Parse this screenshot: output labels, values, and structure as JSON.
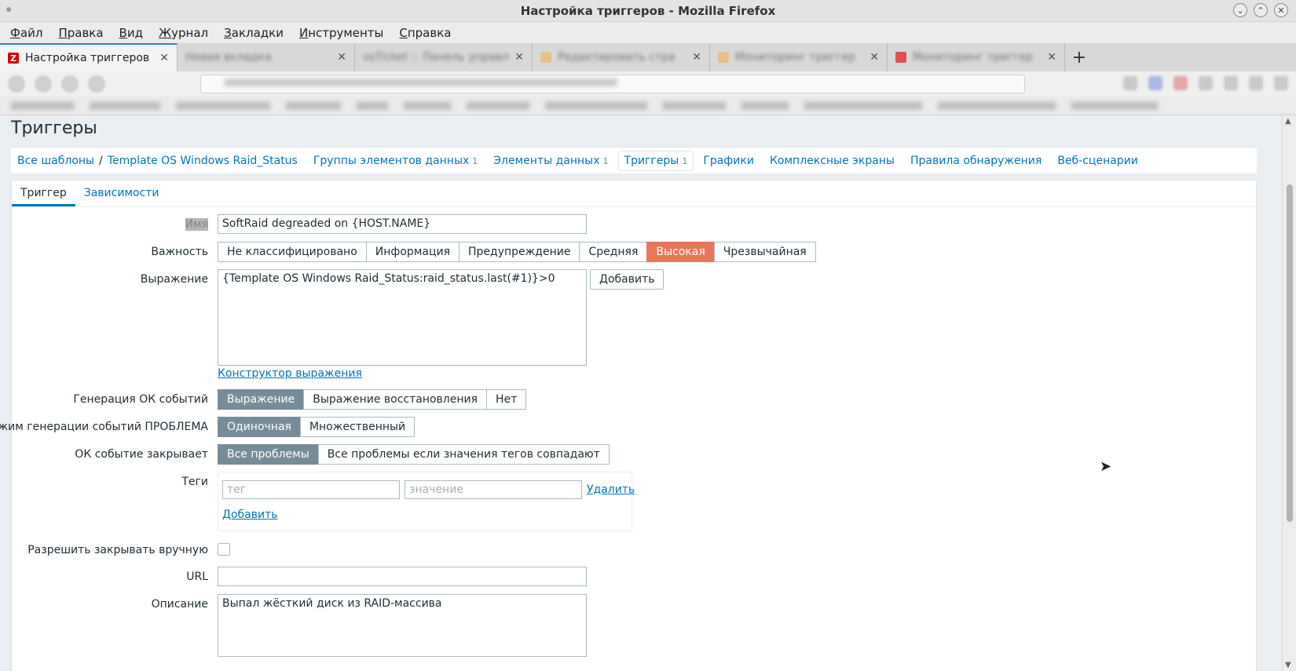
{
  "window": {
    "title": "Настройка триггеров - Mozilla Firefox"
  },
  "menu": [
    "Файл",
    "Правка",
    "Вид",
    "Журнал",
    "Закладки",
    "Инструменты",
    "Справка"
  ],
  "tabs": [
    {
      "label": "Настройка триггеров",
      "active": true
    },
    {
      "label": "Новая вкладка"
    },
    {
      "label": "osTicket :: Панель управл"
    },
    {
      "label": "Редактировать стра"
    },
    {
      "label": "Мониторинг триггер"
    },
    {
      "label": "Мониторинг триггер"
    }
  ],
  "page": {
    "heading": "Триггеры",
    "breadcrumbs": {
      "all_templates": "Все шаблоны",
      "separator": "/",
      "template": "Template OS Windows Raid_Status",
      "item_groups": "Группы элементов данных",
      "item_groups_count": "1",
      "items": "Элементы данных",
      "items_count": "1",
      "triggers": "Триггеры",
      "triggers_count": "1",
      "graphs": "Графики",
      "screens": "Комплексные экраны",
      "discovery": "Правила обнаружения",
      "web": "Веб-сценарии"
    },
    "subtabs": {
      "trigger": "Триггер",
      "dependencies": "Зависимости"
    },
    "form": {
      "name_label": "Имя",
      "name_value": "SoftRaid degreaded on {HOST.NAME}",
      "severity_label": "Важность",
      "severity_options": [
        "Не классифицировано",
        "Информация",
        "Предупреждение",
        "Средняя",
        "Высокая",
        "Чрезвычайная"
      ],
      "severity_selected": "Высокая",
      "expression_label": "Выражение",
      "expression_value": "{Template OS Windows Raid_Status:raid_status.last(#1)}>0",
      "add_button": "Добавить",
      "expression_constructor": "Конструктор выражения",
      "ok_gen_label": "Генерация ОК событий",
      "ok_gen_options": [
        "Выражение",
        "Выражение восстановления",
        "Нет"
      ],
      "problem_mode_label": "Режим генерации событий ПРОБЛЕМА",
      "problem_mode_options": [
        "Одиночная",
        "Множественный"
      ],
      "ok_closes_label": "ОК событие закрывает",
      "ok_closes_options": [
        "Все проблемы",
        "Все проблемы если значения тегов совпадают"
      ],
      "tags_label": "Теги",
      "tag_placeholder": "тег",
      "value_placeholder": "значение",
      "tag_remove": "Удалить",
      "tag_add": "Добавить",
      "manual_close_label": "Разрешить закрывать вручную",
      "url_label": "URL",
      "url_value": "",
      "description_label": "Описание",
      "description_value": "Выпал жёсткий диск из RAID-массива"
    }
  }
}
